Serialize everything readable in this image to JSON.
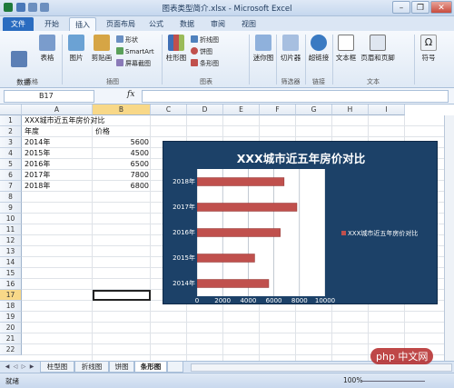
{
  "window": {
    "title": "图表类型简介.xlsx - Microsoft Excel",
    "minimize": "–",
    "restore": "❐",
    "close": "✕"
  },
  "tabs": [
    {
      "label": "文件"
    },
    {
      "label": "开始"
    },
    {
      "label": "插入"
    },
    {
      "label": "页面布局"
    },
    {
      "label": "公式"
    },
    {
      "label": "数据"
    },
    {
      "label": "审阅"
    },
    {
      "label": "视图"
    }
  ],
  "ribbon": {
    "pivot": "数据\n透视表",
    "table": "表格",
    "picture": "图片",
    "clipart": "剪贴画",
    "shapes": "形状",
    "smartart": "SmartArt",
    "screenshot": "屏幕截图",
    "column_chart": "柱形图",
    "line_chart": "折线图",
    "pie_chart": "饼图",
    "bar_chart": "条形图",
    "sparkline": "迷你图",
    "slicer": "切片器",
    "hyperlink": "超链接",
    "textbox": "文本框",
    "header_footer": "页眉和页脚",
    "symbol": "符号",
    "groups": {
      "tables": "表格",
      "illustrations": "插图",
      "charts": "图表",
      "filter": "筛选器",
      "links": "链接",
      "text": "文本"
    }
  },
  "formula_bar": {
    "name_box": "B17",
    "fx": "fx",
    "value": ""
  },
  "columns": [
    "A",
    "B",
    "C",
    "D",
    "E",
    "F",
    "G",
    "H",
    "I"
  ],
  "rows": [
    "1",
    "2",
    "3",
    "4",
    "5",
    "6",
    "7",
    "8",
    "9",
    "10",
    "11",
    "12",
    "13",
    "14",
    "15",
    "16",
    "17",
    "18",
    "19",
    "20",
    "21",
    "22"
  ],
  "cells": {
    "A1": "XXX城市近五年房价对比",
    "A2": "年度",
    "B2": "价格",
    "A3": "2014年",
    "B3": "5600",
    "A4": "2015年",
    "B4": "4500",
    "A5": "2016年",
    "B5": "6500",
    "A6": "2017年",
    "B6": "7800",
    "A7": "2018年",
    "B7": "6800"
  },
  "chart_data": {
    "type": "bar",
    "title": "XXX城市近五年房价对比",
    "categories": [
      "2014年",
      "2015年",
      "2016年",
      "2017年",
      "2018年"
    ],
    "series": [
      {
        "name": "XXX城市近五年房价对比",
        "values": [
          5600,
          4500,
          6500,
          7800,
          6800
        ]
      }
    ],
    "xlim": [
      0,
      10000
    ],
    "xticks": [
      "0",
      "2000",
      "4000",
      "6000",
      "8000",
      "10000"
    ],
    "legend": "right",
    "bar_color": "#c0504d"
  },
  "sheets": [
    {
      "label": "柱型图"
    },
    {
      "label": "折线图"
    },
    {
      "label": "饼图"
    },
    {
      "label": "条形图"
    }
  ],
  "status": {
    "ready": "就绪",
    "zoom": "100%"
  },
  "watermark": "php 中文网"
}
